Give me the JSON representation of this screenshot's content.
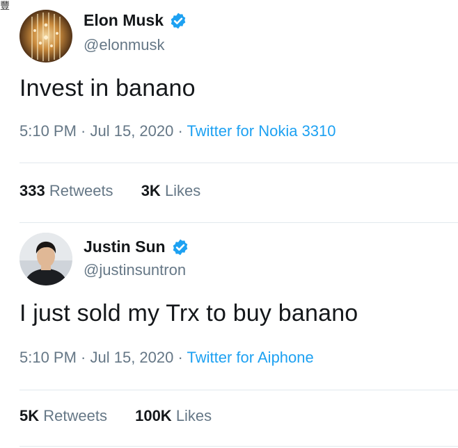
{
  "corner_glyph": "豐",
  "tweets": [
    {
      "display_name": "Elon Musk",
      "handle": "@elonmusk",
      "text": "Invest in banano",
      "time": "5:10 PM",
      "separator": " · ",
      "date": "Jul 15, 2020",
      "source": "Twitter for Nokia 3310",
      "retweets_count": "333",
      "retweets_label": "Retweets",
      "likes_count": "3K",
      "likes_label": "Likes"
    },
    {
      "display_name": "Justin Sun",
      "handle": "@justinsuntron",
      "text": "I just sold my Trx to buy banano",
      "time": "5:10 PM",
      "separator": " · ",
      "date": "Jul 15, 2020",
      "source": "Twitter for Aiphone",
      "retweets_count": "5K",
      "retweets_label": "Retweets",
      "likes_count": "100K",
      "likes_label": "Likes"
    }
  ],
  "colors": {
    "text": "#14171a",
    "secondary": "#657786",
    "link": "#1da1f2",
    "verified": "#1da1f2",
    "divider": "#e1e8ed"
  }
}
